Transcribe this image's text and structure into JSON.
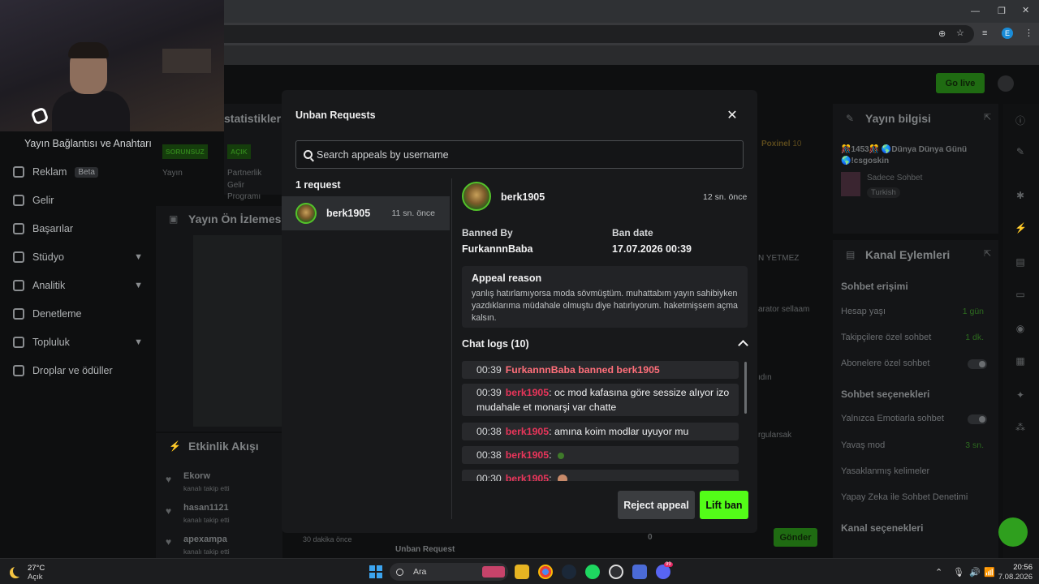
{
  "browser": {
    "profile_initial": "E"
  },
  "header": {
    "go_live_label": "Go live"
  },
  "sidebar": {
    "connection_label": "Yayın Bağlantısı ve Anahtarı",
    "items": [
      {
        "label": "Reklam",
        "badge": "Beta",
        "icon": "megaphone-icon",
        "expandable": false
      },
      {
        "label": "Gelir",
        "icon": "money-icon",
        "expandable": false
      },
      {
        "label": "Başarılar",
        "icon": "trophy-icon",
        "expandable": false
      },
      {
        "label": "Stüdyo",
        "icon": "studio-icon",
        "expandable": true
      },
      {
        "label": "Analitik",
        "icon": "chart-icon",
        "expandable": true
      },
      {
        "label": "Denetleme",
        "icon": "wrench-icon",
        "expandable": false
      },
      {
        "label": "Topluluk",
        "icon": "people-icon",
        "expandable": true
      },
      {
        "label": "Droplar ve ödüller",
        "icon": "gift-icon",
        "expandable": false
      }
    ]
  },
  "background": {
    "stats_title": "statistikleri",
    "badge_unlimited": "SORUNSUZ",
    "badge_open": "AÇIK",
    "stream_label": "Yayın",
    "partnership_lines": [
      "Partnerlik",
      "Gelir",
      "Programı"
    ],
    "preview_title": "Yayın Ön İzlemesi",
    "activity_title": "Etkinlik Akışı",
    "activity": [
      {
        "user": "Ekorw",
        "action": "kanalı takip etti"
      },
      {
        "user": "hasan1121",
        "action": "kanalı takip etti"
      },
      {
        "user": "apexampa",
        "action": "kanalı takip etti"
      }
    ],
    "activity_time": "30 dakika önce",
    "unban_request_label": "Unban Request",
    "poxinel_label": "Poxinel",
    "poxinel_count": "10",
    "chat_fragment_1": "N YETMEZ",
    "chat_fragment_2": "arator sellaam",
    "chat_fragment_3": "ıdın",
    "chat_fragment_4": "rgularsak",
    "viewer_count": "0",
    "send_label": "Gönder"
  },
  "stream_info": {
    "title": "Yayın bilgisi",
    "stream_title": "🎊1453🎊 🌎Dünya Dünya Günü 🌎!csgoskin",
    "chat_mode": "Sadece Sohbet",
    "language": "Turkish"
  },
  "channel_actions": {
    "title": "Kanal Eylemleri",
    "chat_access_heading": "Sohbet erişimi",
    "account_age_label": "Hesap yaşı",
    "account_age_value": "1 gün",
    "followers_only_label": "Takipçilere özel sohbet",
    "followers_only_value": "1 dk.",
    "subscribers_only_label": "Abonelere özel sohbet",
    "chat_options_heading": "Sohbet seçenekleri",
    "emote_only_label": "Yalnızca Emotiarla sohbet",
    "slow_mode_label": "Yavaş mod",
    "slow_mode_value": "3 sn.",
    "banned_words_label": "Yasaklanmış kelimeler",
    "ai_moderation_label": "Yapay Zeka ile Sohbet Denetimi",
    "channel_options_heading": "Kanal seçenekleri"
  },
  "modal": {
    "title": "Unban Requests",
    "search_placeholder": "Search appeals by username",
    "request_count_label": "1 request",
    "requests": [
      {
        "username": "berk1905",
        "time_ago": "11 sn. önce"
      }
    ],
    "detail": {
      "username": "berk1905",
      "time_ago": "12 sn. önce",
      "banned_by_label": "Banned By",
      "banned_by_value": "FurkannnBaba",
      "ban_date_label": "Ban date",
      "ban_date_value": "17.07.2026 00:39",
      "appeal_reason_label": "Appeal reason",
      "appeal_reason_text": "yanlış hatırlamıyorsa moda sövmüştüm. muhattabım yayın sahibiyken yazdıklarıma müdahale olmuştu diye hatırlıyorum. haketmişsem açma kalsın.",
      "chat_logs_label": "Chat logs (10)",
      "chat_logs": [
        {
          "time": "00:39",
          "system": "FurkannnBaba banned berk1905"
        },
        {
          "time": "00:39",
          "user": "berk1905",
          "message": ": oc mod kafasına göre sessize alıyor izo mudahale et monarşi var chatte"
        },
        {
          "time": "00:38",
          "user": "berk1905",
          "message": ": amına koim modlar uyuyor mu"
        },
        {
          "time": "00:38",
          "user": "berk1905",
          "message": ":"
        },
        {
          "time": "00:30",
          "user": "berk1905",
          "message": ":"
        }
      ]
    },
    "reject_label": "Reject appeal",
    "lift_label": "Lift ban"
  },
  "taskbar": {
    "weather_temp": "27°C",
    "weather_desc": "Açık",
    "search_label": "Ara",
    "time": "20:56",
    "date": "7.08.2026",
    "discord_badge": "99"
  },
  "colors": {
    "accent_green": "#53fc18",
    "danger_red": "#e8355a",
    "system_red": "#ff6f7a",
    "modal_bg": "#18191b"
  }
}
